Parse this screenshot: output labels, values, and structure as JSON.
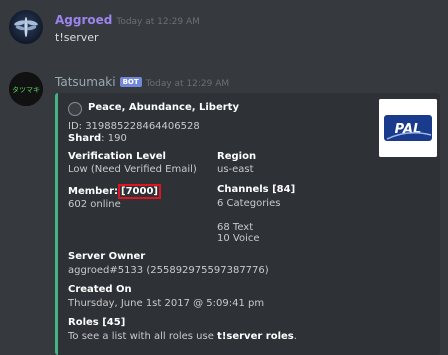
{
  "message1": {
    "username": "Aggroed",
    "timestamp": "Today at 12:29 AM",
    "text": "t!server"
  },
  "message2": {
    "username": "Tatsumaki",
    "bot_badge": "BOT",
    "timestamp": "Today at 12:29 AM",
    "avatar_text": "タツマキ"
  },
  "embed": {
    "accent_color": "#43b581",
    "author": "Peace, Abundance, Liberty",
    "id_line": "ID: 319885228464406528",
    "shard_label": "Shard",
    "shard_value": ": 190",
    "thumbnail_text": "PAL",
    "verification_name": "Verification Level",
    "verification_value": "Low (Need Verified Email)",
    "region_name": "Region",
    "region_value": "us-east",
    "members_name": "Member:",
    "members_count": "[7000]",
    "members_online": "602 online",
    "channels_name": "Channels [84]",
    "channels_categories": "6 Categories",
    "channels_text": "68 Text",
    "channels_voice": "10 Voice",
    "owner_name": "Server Owner",
    "owner_value": "aggroed#5133 (255892975597387776)",
    "created_name": "Created On",
    "created_value": "Thursday, June 1st 2017 @ 5:09:41 pm",
    "roles_name": "Roles [45]",
    "roles_prefix": "To see a list with all roles use ",
    "roles_cmd": "t!server roles",
    "roles_suffix": "."
  }
}
